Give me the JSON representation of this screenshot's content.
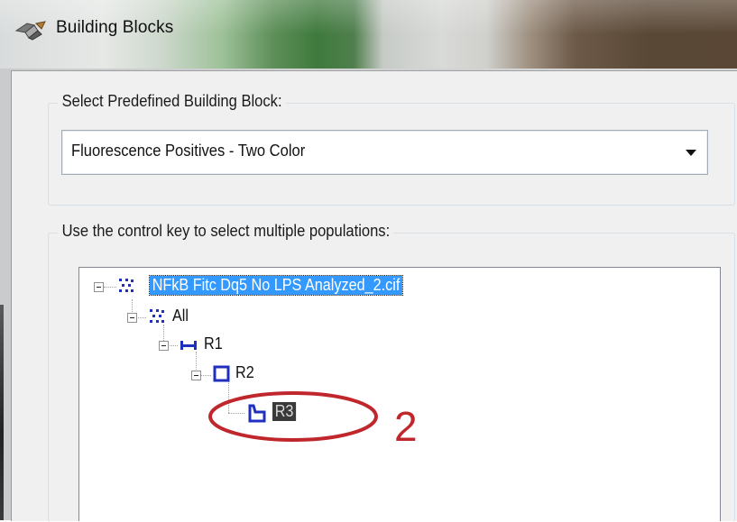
{
  "window": {
    "title": "Building Blocks",
    "icon": "building-blocks-app-icon"
  },
  "predefined": {
    "label": "Select Predefined Building Block:",
    "selected": "Fluorescence Positives - Two Color"
  },
  "populations": {
    "label": "Use the control key to select multiple populations:",
    "tree": {
      "root": {
        "label": "NFkB Fitc Dq5 No LPS Analyzed_2.cif",
        "icon": "scatter-dots-icon",
        "selected": true
      },
      "all": {
        "label": "All",
        "icon": "scatter-dots-icon"
      },
      "r1": {
        "label": "R1",
        "icon": "line-gate-icon"
      },
      "r2": {
        "label": "R2",
        "icon": "rectangle-gate-icon"
      },
      "r3": {
        "label": "R3",
        "icon": "polygon-gate-icon",
        "selected": true
      }
    }
  },
  "annotation": {
    "number": "2",
    "color": "#c0272d"
  },
  "colors": {
    "selection": "#3399ff",
    "gate_icon": "#1f2fbf"
  }
}
